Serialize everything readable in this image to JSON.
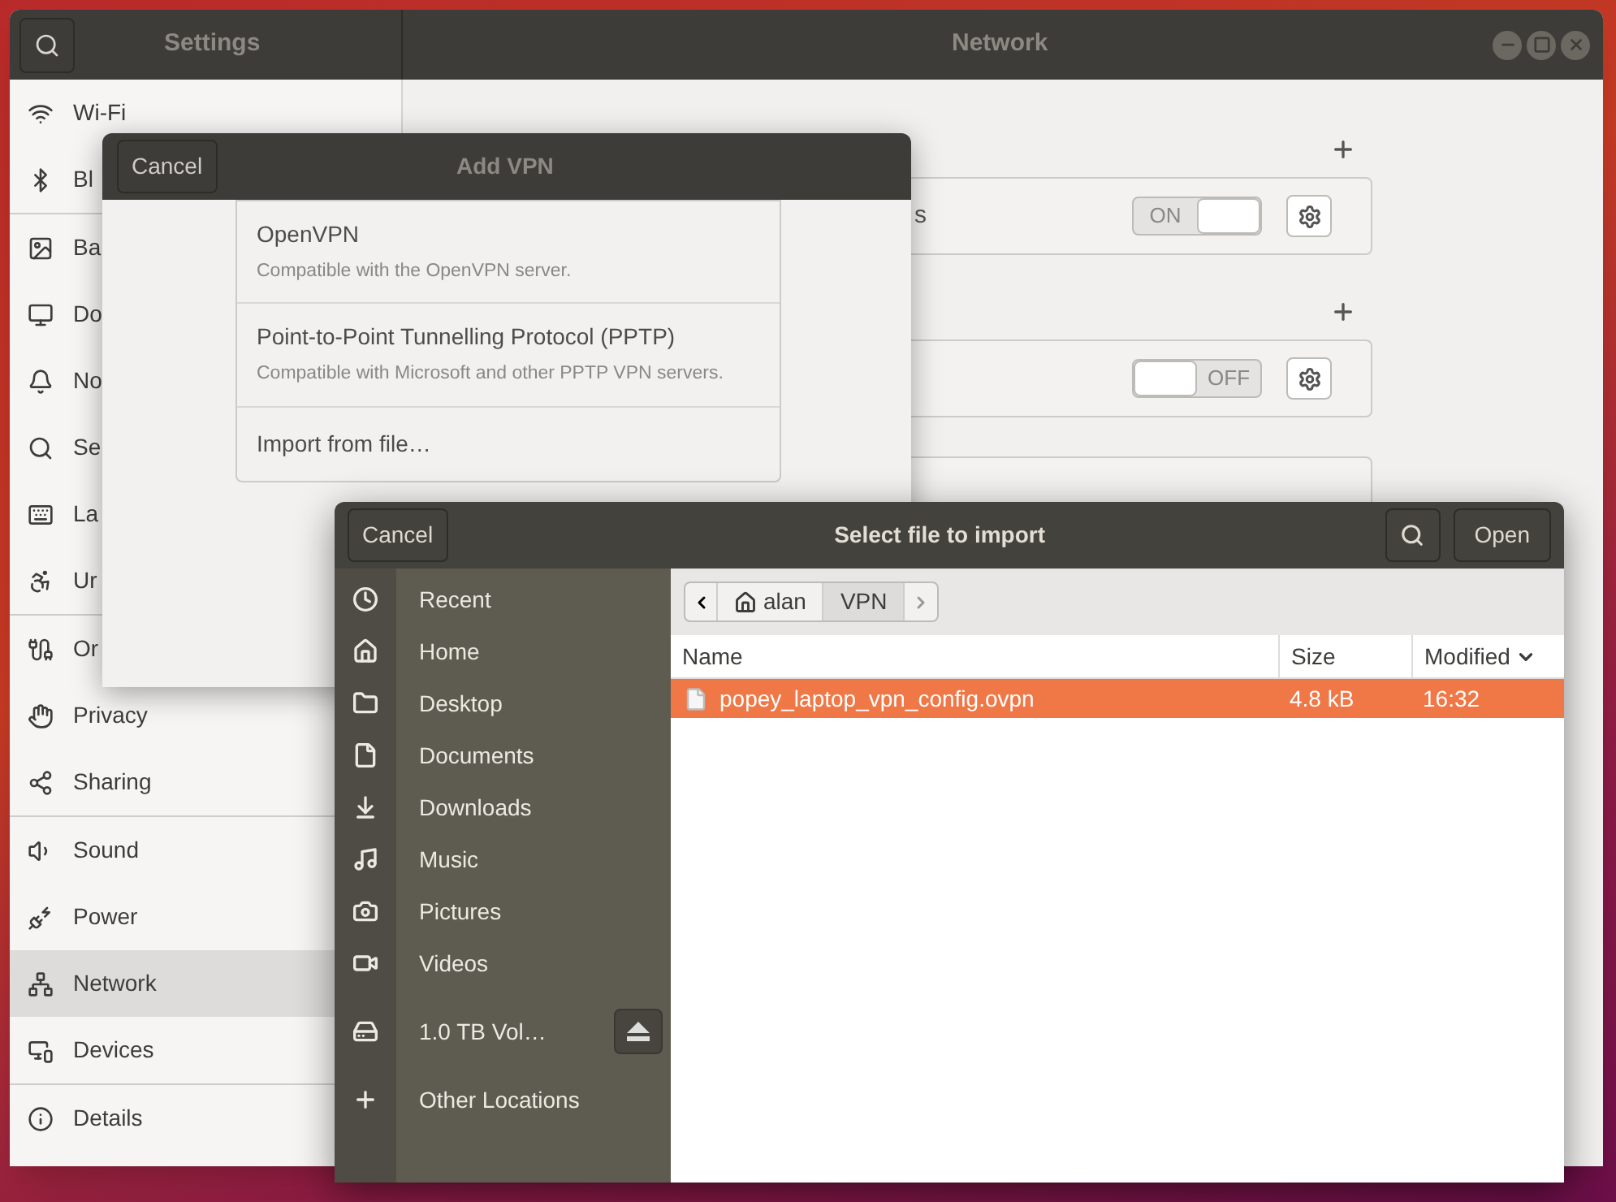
{
  "settings_window": {
    "search_button": {
      "kind": "search"
    },
    "sidebar_title": "Settings",
    "title": "Network"
  },
  "sidebar": {
    "groups": [
      [
        {
          "label": "Wi-Fi",
          "selected": false
        },
        {
          "label": "Bl",
          "selected": false
        }
      ],
      [
        {
          "label": "Ba",
          "selected": false
        },
        {
          "label": "Do",
          "selected": false
        },
        {
          "label": "No",
          "selected": false
        },
        {
          "label": "Se",
          "selected": false
        },
        {
          "label": "La",
          "selected": false
        },
        {
          "label": "Ur",
          "selected": false
        }
      ],
      [
        {
          "label": "Or",
          "selected": false
        },
        {
          "label": "Privacy",
          "selected": false
        },
        {
          "label": "Sharing",
          "selected": false
        }
      ],
      [
        {
          "label": "Sound",
          "selected": false
        },
        {
          "label": "Power",
          "selected": false
        },
        {
          "label": "Network",
          "selected": true
        },
        {
          "label": "Devices",
          "selected": false
        }
      ],
      [
        {
          "label": "Details",
          "selected": false
        }
      ]
    ]
  },
  "network": {
    "sections": [
      {
        "cards": [
          {
            "kind": "switch",
            "label": "s",
            "on": true,
            "switch_text": "ON"
          }
        ]
      },
      {
        "cards": [
          {
            "kind": "switch",
            "on": false,
            "switch_text": "OFF"
          },
          {
            "kind": "hidden"
          }
        ]
      }
    ]
  },
  "add_vpn_dialog": {
    "cancel": "Cancel",
    "title": "Add VPN",
    "options": [
      {
        "title": "OpenVPN",
        "description": "Compatible with the OpenVPN server."
      },
      {
        "title": "Point-to-Point Tunnelling Protocol (PPTP)",
        "description": "Compatible with Microsoft and other PPTP VPN servers."
      },
      {
        "title": "Import from file…"
      }
    ]
  },
  "file_dialog": {
    "cancel": "Cancel",
    "title": "Select file to import",
    "open": "Open",
    "places": [
      [
        {
          "label": "Recent"
        },
        {
          "label": "Home"
        },
        {
          "label": "Desktop"
        },
        {
          "label": "Documents"
        },
        {
          "label": "Downloads"
        },
        {
          "label": "Music"
        },
        {
          "label": "Pictures"
        },
        {
          "label": "Videos"
        }
      ],
      [
        {
          "label": "1.0 TB Vol…",
          "eject": true
        }
      ],
      [
        {
          "label": "Other Locations"
        }
      ]
    ],
    "path": [
      {
        "label": "alan",
        "home": true,
        "selected": false
      },
      {
        "label": "VPN",
        "home": false,
        "selected": true
      }
    ],
    "columns": [
      {
        "label": "Name",
        "sorted": false
      },
      {
        "label": "Size",
        "sorted": false
      },
      {
        "label": "Modified",
        "sorted": true
      }
    ],
    "files": [
      {
        "name": "popey_laptop_vpn_config.ovpn",
        "size": "4.8 kB",
        "modified": "16:32",
        "selected": true
      }
    ]
  }
}
